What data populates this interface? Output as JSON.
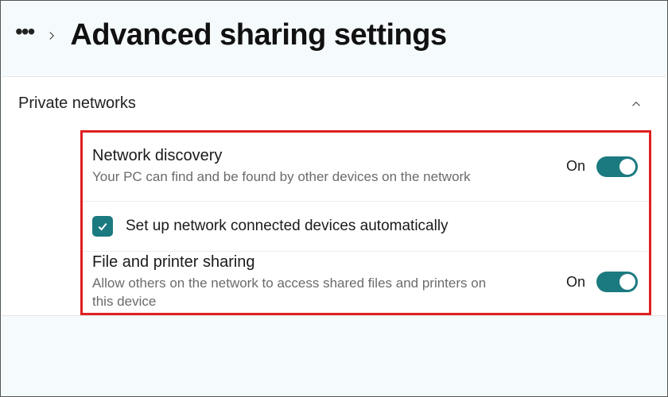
{
  "header": {
    "title": "Advanced sharing settings"
  },
  "section": {
    "title": "Private networks"
  },
  "items": {
    "discovery": {
      "title": "Network discovery",
      "desc": "Your PC can find and be found by other devices on the network",
      "state": "On"
    },
    "autosetup": {
      "label": "Set up network connected devices automatically"
    },
    "fileprint": {
      "title": "File and printer sharing",
      "desc": "Allow others on the network to access shared files and printers on this device",
      "state": "On"
    }
  }
}
